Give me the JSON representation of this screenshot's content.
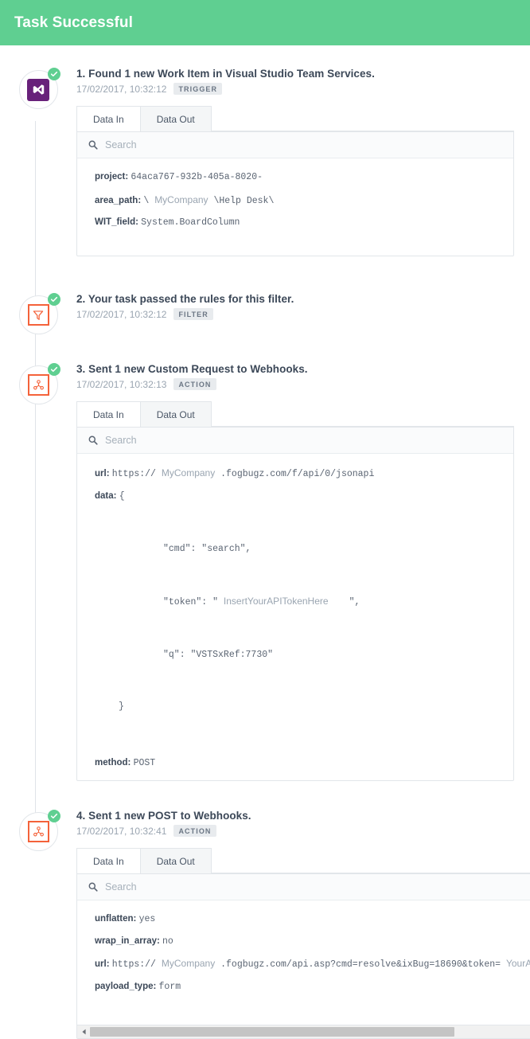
{
  "header": {
    "title": "Task Successful",
    "accent_color": "#5fcf91"
  },
  "colors": {
    "success_green": "#5fcf91",
    "action_orange": "#f4623a",
    "vs_purple": "#68217a",
    "text_dark": "#3c4858",
    "text_muted": "#9aa5b1",
    "border": "#e2e6ea"
  },
  "panel_ui": {
    "tab_data_in": "Data In",
    "tab_data_out": "Data Out",
    "search_placeholder": "Search",
    "search_icon": "search-icon"
  },
  "steps": [
    {
      "index": "1",
      "title": "1. Found 1 new Work Item in Visual Studio Team Services.",
      "timestamp": "17/02/2017, 10:32:12",
      "badge": "TRIGGER",
      "icon": "visual-studio-icon",
      "status": "success",
      "has_panel": true,
      "active_tab": "Data In",
      "fields": [
        {
          "key": "project:",
          "value": "64aca767-932b-405a-8020-"
        },
        {
          "key": "area_path:",
          "value": "\\ ",
          "redacted": "MyCompany",
          "value_after": " \\Help Desk\\"
        },
        {
          "key": "WIT_field:",
          "value": "System.BoardColumn"
        }
      ]
    },
    {
      "index": "2",
      "title": "2. Your task passed the rules for this filter.",
      "timestamp": "17/02/2017, 10:32:12",
      "badge": "FILTER",
      "icon": "filter-funnel-icon",
      "status": "success",
      "has_panel": false
    },
    {
      "index": "3",
      "title": "3. Sent 1 new Custom Request to Webhooks.",
      "timestamp": "17/02/2017, 10:32:13",
      "badge": "ACTION",
      "icon": "webhooks-icon",
      "status": "success",
      "has_panel": true,
      "active_tab": "Data In",
      "fields": [
        {
          "key": "url:",
          "value": "https:// ",
          "redacted": "MyCompany",
          "value_after": " .fogbugz.com/f/api/0/jsonapi"
        },
        {
          "key": "data:",
          "value": "{"
        },
        {
          "key": "method:",
          "value": "POST"
        }
      ],
      "json_lines": {
        "cmd": "\"cmd\": \"search\",",
        "token_prefix": "\"token\": \" ",
        "token_redacted": "InsertYourAPITokenHere",
        "token_suffix": "\",",
        "q": "\"q\": \"VSTSxRef:7730\"",
        "close_brace": "}"
      }
    },
    {
      "index": "4",
      "title": "4. Sent 1 new POST to Webhooks.",
      "timestamp": "17/02/2017, 10:32:41",
      "badge": "ACTION",
      "icon": "webhooks-icon",
      "status": "success",
      "has_panel": true,
      "active_tab": "Data In",
      "has_scrollbar": true,
      "fields": [
        {
          "key": "unflatten:",
          "value": "yes"
        },
        {
          "key": "wrap_in_array:",
          "value": "no"
        },
        {
          "key": "url:",
          "value": "https:// ",
          "redacted": "MyCompany",
          "value_after": " .fogbugz.com/api.asp?cmd=resolve&ixBug=18690&token= ",
          "redacted_tail": "YourAPI"
        },
        {
          "key": "payload_type:",
          "value": "form"
        }
      ]
    }
  ]
}
